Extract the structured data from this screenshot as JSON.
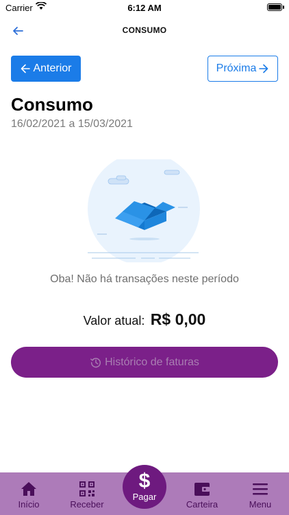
{
  "status_bar": {
    "carrier": "Carrier",
    "time": "6:12 AM"
  },
  "nav": {
    "title": "CONSUMO"
  },
  "period": {
    "prev_label": "Anterior",
    "next_label": "Próxima"
  },
  "page": {
    "title": "Consumo",
    "date_range": "16/02/2021 a 15/03/2021"
  },
  "empty_state": {
    "message": "Oba! Não há transações neste período"
  },
  "balance": {
    "label": "Valor atual:",
    "amount": "R$ 0,00"
  },
  "history_button": {
    "label": "Histórico de faturas"
  },
  "tabs": [
    {
      "label": "Início",
      "icon": "home-icon"
    },
    {
      "label": "Receber",
      "icon": "qr-code-icon"
    },
    {
      "label": "Pagar",
      "icon": "dollar-icon"
    },
    {
      "label": "Carteira",
      "icon": "wallet-icon"
    },
    {
      "label": "Menu",
      "icon": "menu-icon"
    }
  ],
  "colors": {
    "accent_blue": "#1b7ce8",
    "purple": "#7b2089",
    "tabbar_bg": "#ad7bb9",
    "tab_icon": "#4a0f5a"
  }
}
